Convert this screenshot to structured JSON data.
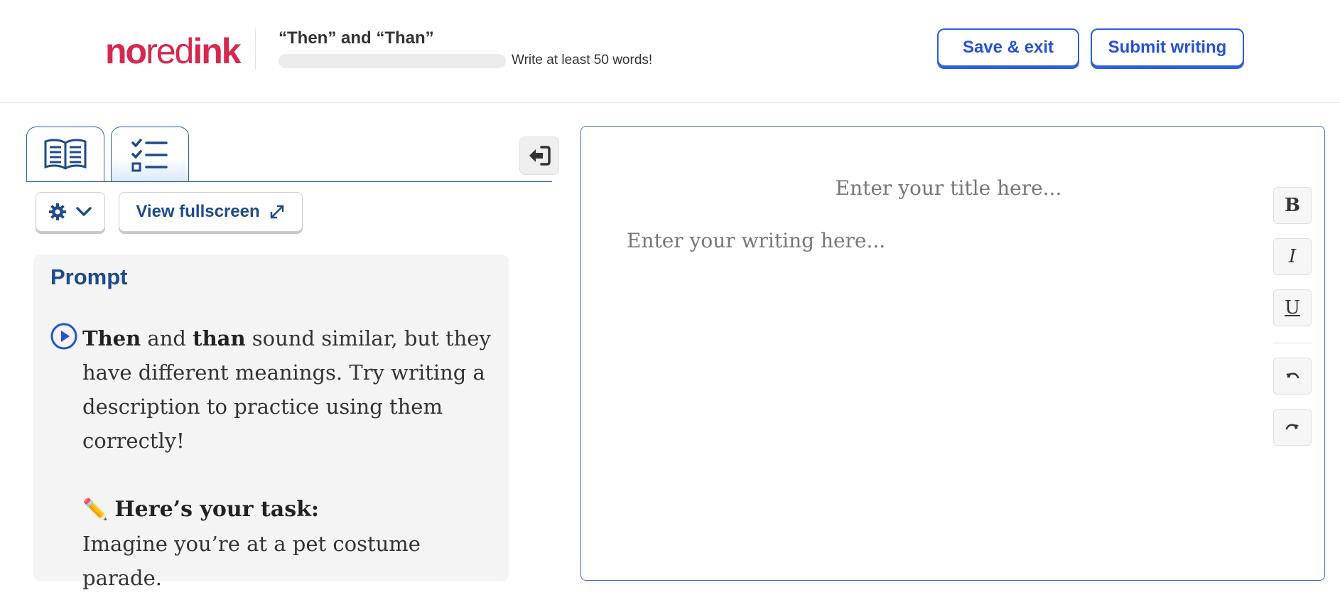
{
  "header": {
    "logo": {
      "part1": "no",
      "part2": "red",
      "part3": "ink"
    },
    "assignment_title": "“Then” and “Than”",
    "progress": {
      "value": 0,
      "text": "Write at least 50 words!"
    },
    "save_label": "Save & exit",
    "submit_label": "Submit writing"
  },
  "left_panel": {
    "tabs": [
      {
        "icon": "book-icon"
      },
      {
        "icon": "checklist-icon"
      }
    ],
    "fullscreen_label": "View fullscreen",
    "prompt": {
      "heading": "Prompt",
      "intro": {
        "w1": "Then",
        "t1": " and ",
        "w2": "than",
        "t2": " sound similar, but they have different meanings. Try writing a description to practice using them correctly!"
      },
      "task_emoji": "✏️",
      "task_heading": "Here’s your task:",
      "task_text": "Imagine you’re at a pet costume parade."
    }
  },
  "editor": {
    "title_placeholder": "Enter your title here...",
    "body_placeholder": "Enter your writing here...",
    "tools": [
      {
        "label": "B",
        "icon": "bold-icon"
      },
      {
        "label": "I",
        "icon": "italic-icon"
      },
      {
        "label": "U",
        "icon": "underline-icon"
      },
      {
        "label": "",
        "icon": "undo-icon"
      },
      {
        "label": "",
        "icon": "redo-icon"
      }
    ]
  },
  "colors": {
    "brand": "#d6284e",
    "primary_blue": "#2452d6",
    "navy": "#1e4a8c",
    "prompt_bg": "#f4f4f4"
  }
}
